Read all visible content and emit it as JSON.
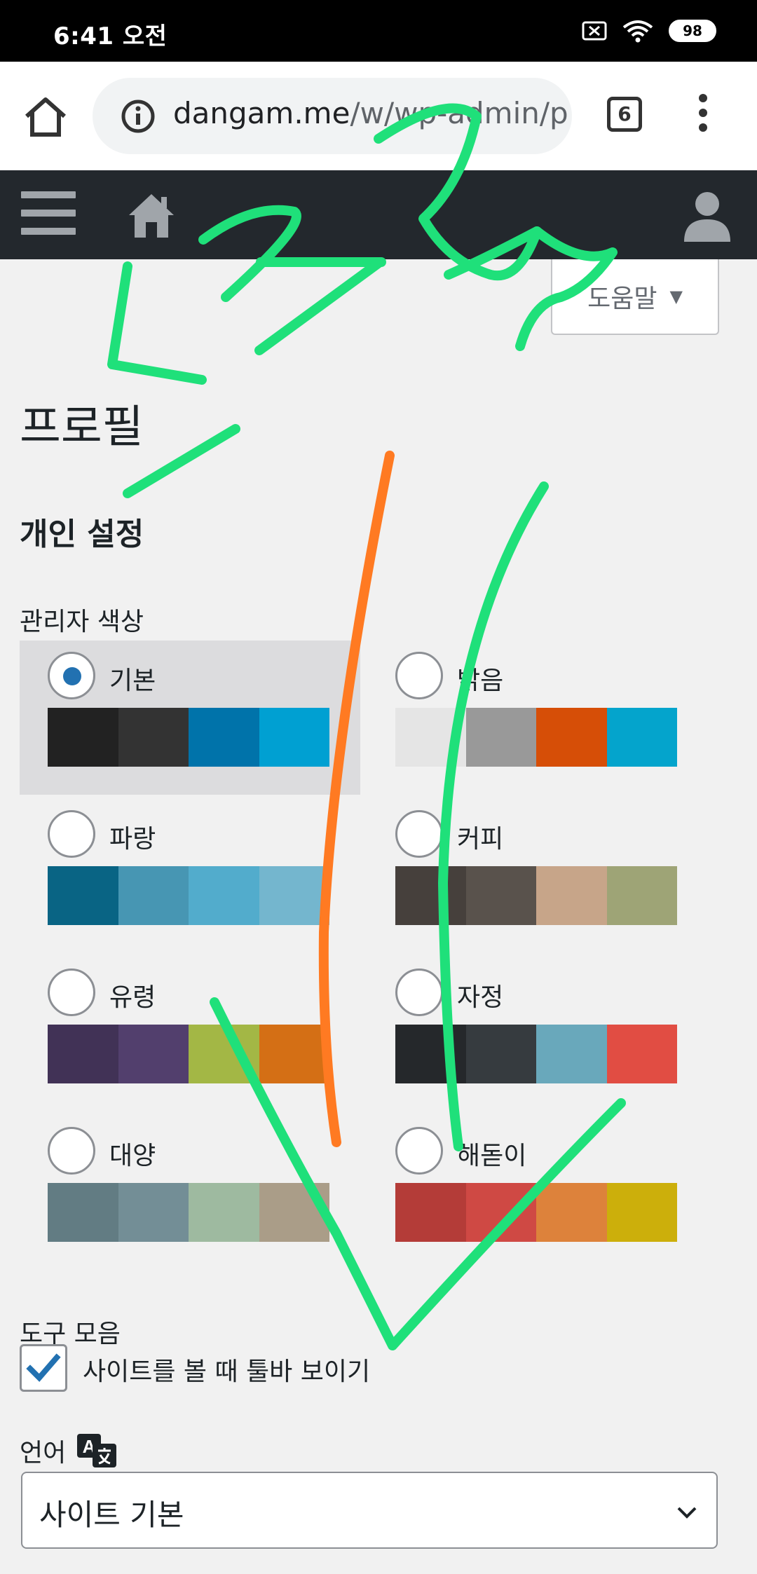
{
  "status_bar": {
    "time": "6:41 오전",
    "battery_level": "98",
    "icons": [
      "notification-muted-icon",
      "wifi-icon",
      "battery-icon"
    ]
  },
  "browser": {
    "url_domain": "dangam.me",
    "url_path": "/w/wp-admin/p",
    "tab_count": "6",
    "icons": [
      "home-icon",
      "info-icon",
      "tabs-icon",
      "more-vert-icon"
    ]
  },
  "admin_bar": {
    "icons": [
      "menu-icon",
      "home-icon",
      "user-icon"
    ]
  },
  "help": {
    "label": "도움말"
  },
  "page": {
    "title": "프로필",
    "section_title": "개인 설정"
  },
  "admin_color": {
    "label": "관리자 색상",
    "selected": "기본",
    "schemes": [
      {
        "name": "기본",
        "colors": [
          "#222222",
          "#333333",
          "#0073aa",
          "#00a0d2"
        ]
      },
      {
        "name": "밝음",
        "colors": [
          "#e5e5e5",
          "#999999",
          "#d64e07",
          "#04a4cc"
        ]
      },
      {
        "name": "파랑",
        "colors": [
          "#096484",
          "#4796b3",
          "#52accc",
          "#74b6ce"
        ]
      },
      {
        "name": "커피",
        "colors": [
          "#46403c",
          "#59524c",
          "#c7a589",
          "#9ea476"
        ]
      },
      {
        "name": "유령",
        "colors": [
          "#413256",
          "#523f6d",
          "#a3b745",
          "#d46f15"
        ]
      },
      {
        "name": "자정",
        "colors": [
          "#25282b",
          "#363b3f",
          "#69a8bb",
          "#e14d43"
        ]
      },
      {
        "name": "대양",
        "colors": [
          "#627c83",
          "#738e96",
          "#9ebaa0",
          "#aa9d88"
        ]
      },
      {
        "name": "해돋이",
        "colors": [
          "#b43c38",
          "#cf4944",
          "#dd823b",
          "#ccaf0b"
        ]
      }
    ]
  },
  "toolbar": {
    "label": "도구 모음",
    "checkbox_label": "사이트를 볼 때 툴바 보이기",
    "checked": true
  },
  "language": {
    "label": "언어",
    "selected_value": "사이트 기본"
  },
  "colors": {
    "accent": "#2271b1",
    "admin_bar_bg": "#23282d",
    "page_bg": "#f1f1f1",
    "scribble_green": "#1fe07a",
    "scribble_orange": "#ff7a22"
  }
}
